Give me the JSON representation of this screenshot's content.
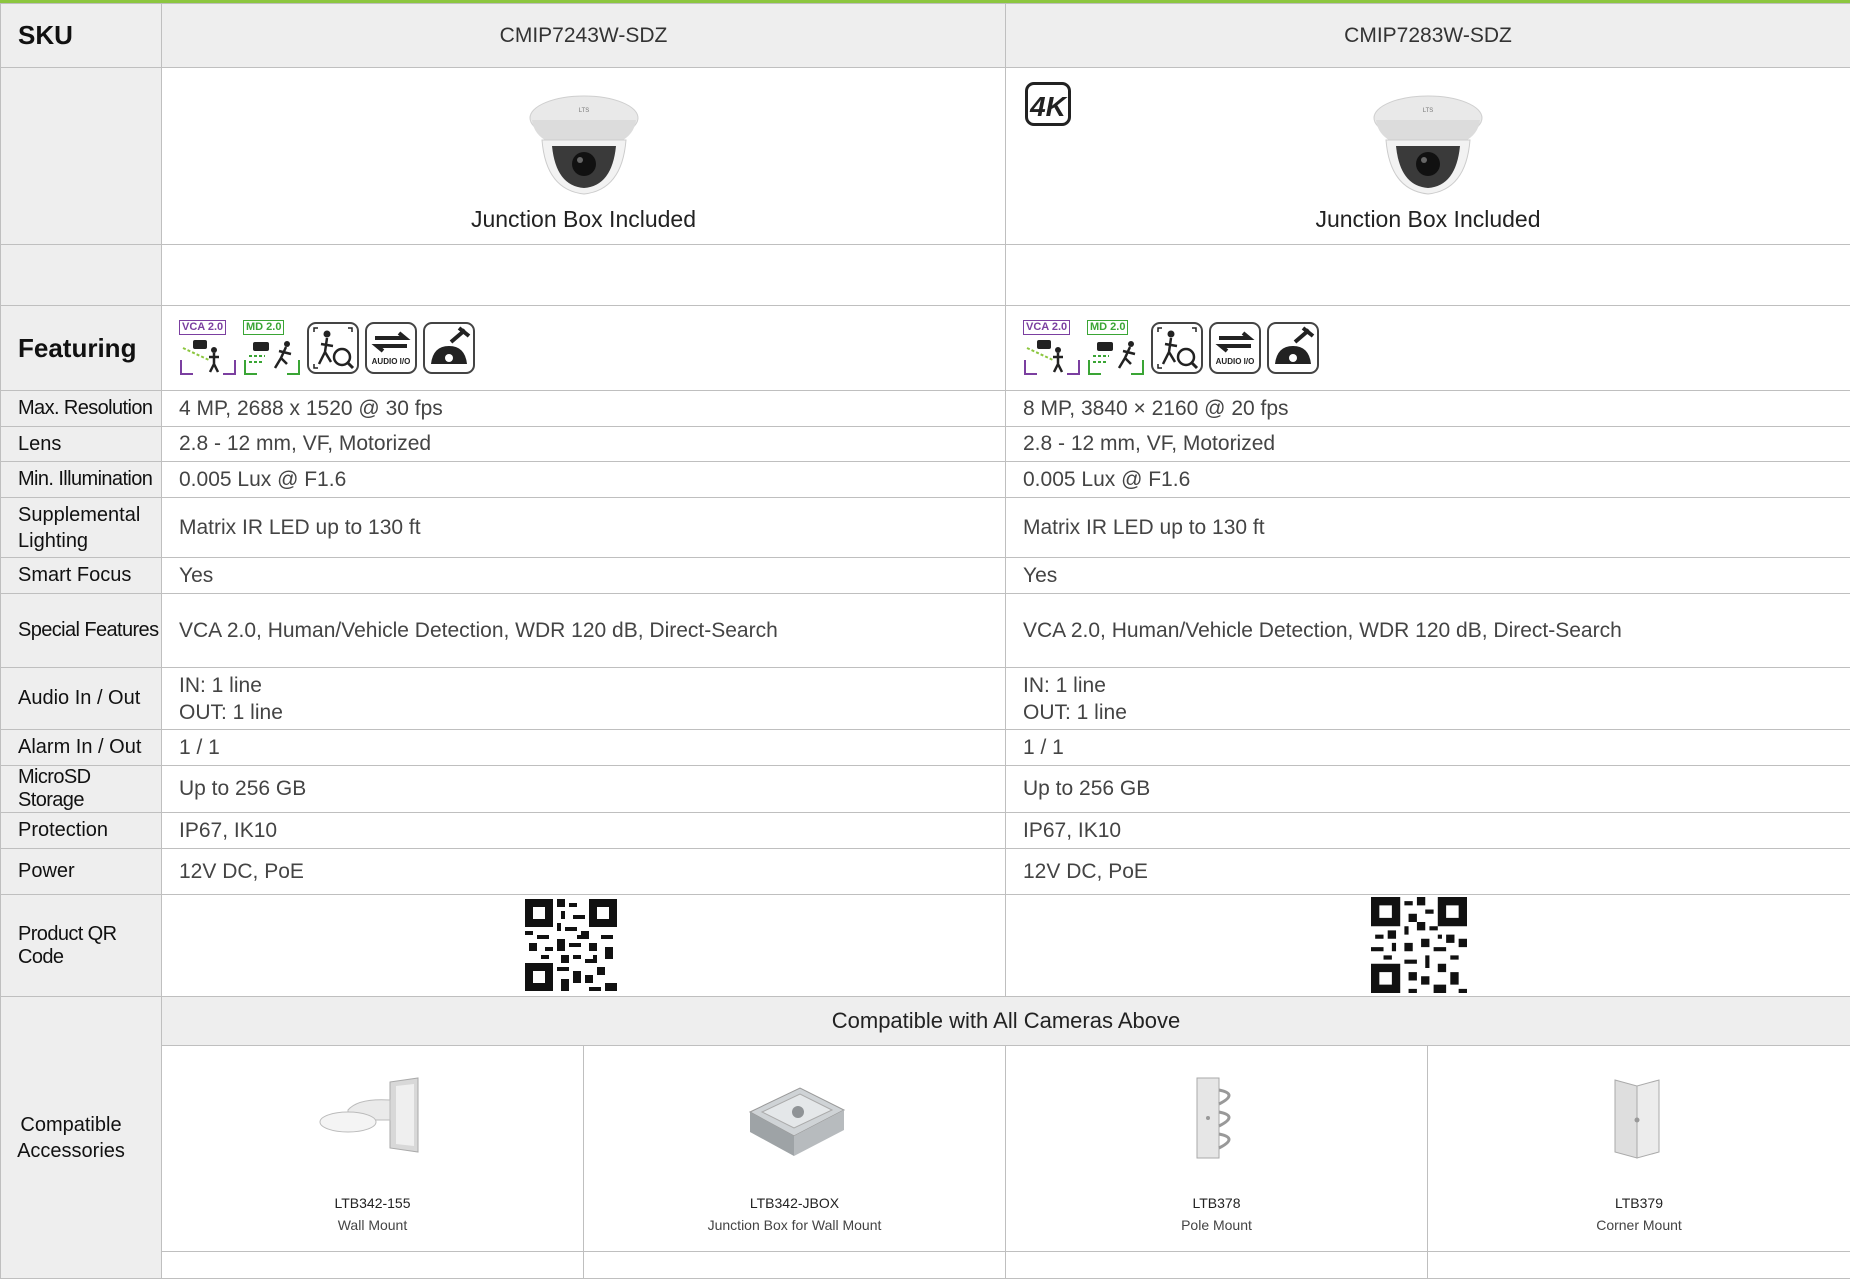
{
  "header": {
    "sku_label": "SKU",
    "models": [
      "CMIP7243W-SDZ",
      "CMIP7283W-SDZ"
    ]
  },
  "images": {
    "caption": "Junction Box Included",
    "badge": "4K"
  },
  "featuring": {
    "label": "Featuring",
    "icons": [
      {
        "name": "vca-2-icon",
        "text": "VCA 2.0"
      },
      {
        "name": "md-2-icon",
        "text": "MD 2.0"
      },
      {
        "name": "direct-search-icon"
      },
      {
        "name": "audio-io-icon",
        "text": "AUDIO I/O"
      },
      {
        "name": "ik10-vandal-icon"
      }
    ]
  },
  "rows": [
    {
      "label": "Max. Resolution",
      "values": [
        "4 MP, 2688 x 1520 @ 30 fps",
        "8 MP, 3840 × 2160 @ 20 fps"
      ]
    },
    {
      "label": "Lens",
      "values": [
        "2.8 - 12 mm, VF, Motorized",
        "2.8 - 12 mm, VF, Motorized"
      ]
    },
    {
      "label": "Min. Illumination",
      "values": [
        "0.005 Lux @ F1.6",
        "0.005 Lux @ F1.6"
      ]
    },
    {
      "label": "Supplemental Lighting",
      "values": [
        "Matrix IR LED up to 130 ft",
        "Matrix IR LED up to 130 ft"
      ]
    },
    {
      "label": "Smart Focus",
      "values": [
        "Yes",
        "Yes"
      ]
    },
    {
      "label": "Special Features",
      "values": [
        "VCA 2.0, Human/Vehicle Detection, WDR 120 dB, Direct-Search",
        "VCA 2.0, Human/Vehicle Detection, WDR 120 dB, Direct-Search"
      ]
    },
    {
      "label": "Audio In / Out",
      "values": [
        "IN: 1 line",
        "IN: 1 line"
      ],
      "values2": [
        "OUT: 1 line",
        "OUT: 1 line"
      ]
    },
    {
      "label": "Alarm In / Out",
      "values": [
        "1 / 1",
        "1 / 1"
      ]
    },
    {
      "label": "MicroSD Storage",
      "values": [
        "Up to 256 GB",
        "Up to 256 GB"
      ]
    },
    {
      "label": "Protection",
      "values": [
        "IP67, IK10",
        "IP67, IK10"
      ]
    },
    {
      "label": "Power",
      "values": [
        "12V DC, PoE",
        "12V DC, PoE"
      ]
    }
  ],
  "qr": {
    "label": "Product QR Code"
  },
  "accessories": {
    "label": "Compatible Accessories",
    "header": "Compatible with All Cameras Above",
    "items": [
      {
        "code": "LTB342-155",
        "name": "Wall Mount"
      },
      {
        "code": "LTB342-JBOX",
        "name": "Junction Box for Wall Mount"
      },
      {
        "code": "LTB378",
        "name": "Pole Mount"
      },
      {
        "code": "LTB379",
        "name": "Corner Mount"
      }
    ]
  }
}
